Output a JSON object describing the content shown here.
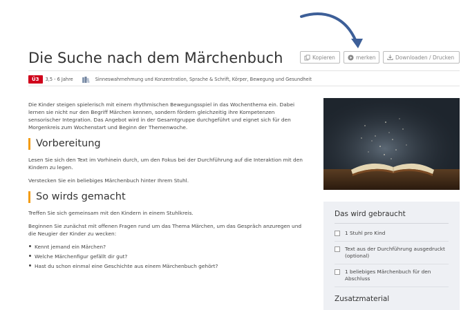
{
  "page": {
    "title": "Die Suche nach dem Märchenbuch"
  },
  "actions": {
    "copy_label": "Kopieren",
    "mark_label": "merken",
    "download_label": "Downloaden / Drucken"
  },
  "meta": {
    "badge": "Ü3",
    "badge_color": "#d0021b",
    "age": "3,5 - 6 Jahre",
    "categories_icon": "books-icon",
    "categories": "Sinneswahrnehmung und Konzentration, Sprache & Schrift, Körper, Bewegung und Gesundheit"
  },
  "intro": "Die Kinder steigen spielerisch mit einem rhythmischen Bewegungsspiel in das Wochenthema ein. Dabei lernen sie nicht nur den Begriff Märchen kennen, sondern fördern gleichzeitig ihre Kompetenzen sensorischer Integration. Das Angebot wird in der Gesamtgruppe durchgeführt und eignet sich für den Morgenkreis zum Wochenstart und Beginn der Themenwoche.",
  "sections": {
    "prep": {
      "heading": "Vorbereitung",
      "p1": "Lesen Sie sich den Text im Vorhinein durch, um den Fokus bei der Durchführung auf die Interaktion mit den Kindern zu legen.",
      "p2": "Verstecken Sie ein beliebiges Märchenbuch hinter Ihrem Stuhl."
    },
    "howto": {
      "heading": "So wirds gemacht",
      "p1": "Treffen Sie sich gemeinsam mit den Kindern in einem Stuhlkreis.",
      "p2": "Beginnen Sie zunächst mit offenen Fragen rund um das Thema Märchen, um das Gespräch anzuregen und die Neugier der Kinder zu wecken:",
      "bullets": [
        "Kennt jemand ein Märchen?",
        "Welche Märchenfigur gefällt dir gut?",
        "Hast du schon einmal eine Geschichte aus einem Märchenbuch gehört?"
      ]
    }
  },
  "sidebar": {
    "title": "Das wird gebraucht",
    "items": [
      "1 Stuhl pro Kind",
      "Text aus der Durchführung ausgedruckt (optional)",
      "1 beliebiges Märchenbuch für den Abschluss"
    ],
    "extra_title": "Zusatzmaterial"
  },
  "colors": {
    "accent": "#f39c12",
    "arrow": "#3d5f98",
    "sidebar_bg": "#eef0f4"
  }
}
